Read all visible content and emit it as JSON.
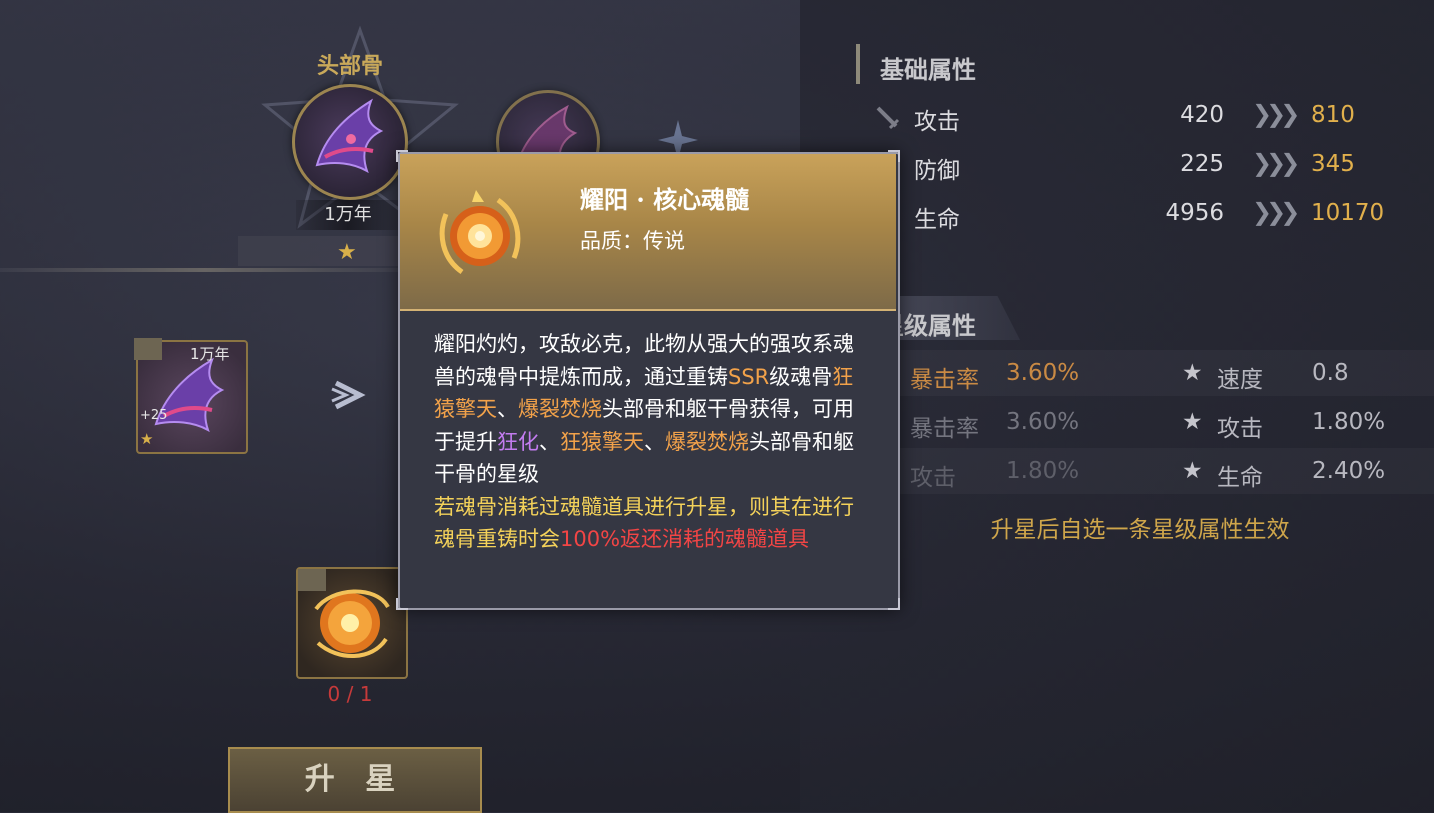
{
  "left": {
    "slot_title": "头部骨",
    "bone_age": "1万年",
    "card": {
      "age": "1万年",
      "level": "+25"
    },
    "orb_count": "0 / 1",
    "upstar_button": "升 星"
  },
  "basic_attrs": {
    "title": "基础属性",
    "rows": [
      {
        "label": "攻击",
        "base": "420",
        "after": "810",
        "icon": "sword-icon"
      },
      {
        "label": "防御",
        "base": "225",
        "after": "345",
        "icon": "shield-icon"
      },
      {
        "label": "生命",
        "base": "4956",
        "after": "10170",
        "icon": "heart-icon"
      }
    ]
  },
  "star_attrs": {
    "title": "星级属性",
    "rows": [
      {
        "left_label": "暴击率",
        "left_value": "3.60%",
        "right_label": "速度",
        "right_value": "0.8"
      },
      {
        "left_label": "暴击率",
        "left_value": "3.60%",
        "right_label": "攻击",
        "right_value": "1.80%"
      },
      {
        "left_label": "攻击",
        "left_value": "1.80%",
        "right_label": "生命",
        "right_value": "2.40%"
      }
    ],
    "note": "升星后自选一条星级属性生效"
  },
  "tooltip": {
    "name": "耀阳 · 核心魂髓",
    "quality": "品质：传说",
    "desc": [
      {
        "text": "耀阳灼灼，攻敌必克，此物从强大的强攻系魂兽的魂骨中提炼而成，通过重铸",
        "color": "white"
      },
      {
        "text": "SSR",
        "color": "orange"
      },
      {
        "text": "级魂骨",
        "color": "white"
      },
      {
        "text": "狂猿擎天",
        "color": "orange"
      },
      {
        "text": "、",
        "color": "white"
      },
      {
        "text": "爆裂焚烧",
        "color": "orange"
      },
      {
        "text": "头部骨和躯干骨获得，可用于提升",
        "color": "white"
      },
      {
        "text": "狂化",
        "color": "purple"
      },
      {
        "text": "、",
        "color": "white"
      },
      {
        "text": "狂猿擎天",
        "color": "orange"
      },
      {
        "text": "、",
        "color": "white"
      },
      {
        "text": "爆裂焚烧",
        "color": "orange"
      },
      {
        "text": "头部骨和躯干骨的星级",
        "color": "white"
      },
      {
        "text": "若魂骨消耗过魂髓道具进行升星，则其在进行魂骨重铸时会",
        "color": "yellow"
      },
      {
        "text": "100%返还消耗的魂髓道具",
        "color": "red"
      }
    ]
  },
  "colors": {
    "gold": "#e1b04c",
    "orange": "#f2a24a",
    "purple": "#c37cf0",
    "yellow": "#f4d25a",
    "red": "#f24545"
  }
}
